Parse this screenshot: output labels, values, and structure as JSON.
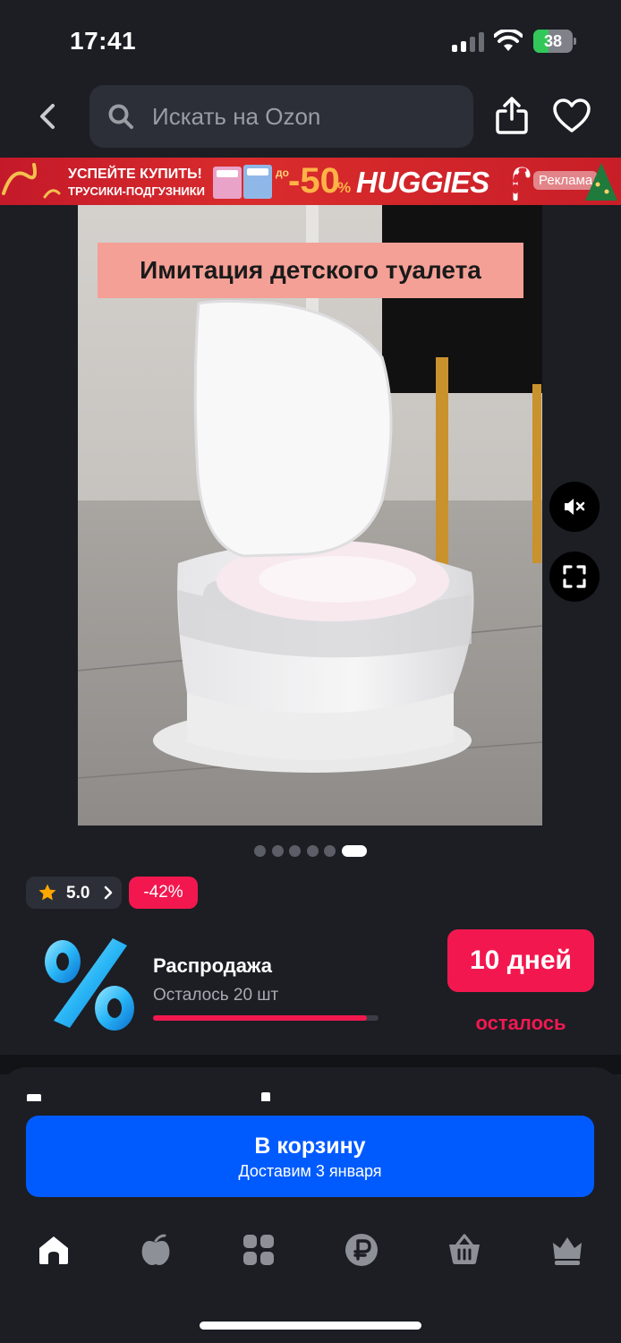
{
  "status_bar": {
    "time": "17:41",
    "battery_level": "38",
    "battery_charge_fraction": 0.38
  },
  "header": {
    "search_placeholder": "Искать на Ozon"
  },
  "promo": {
    "line1": "УСПЕЙТЕ КУПИТЬ!",
    "line2": "ТРУСИКИ-ПОДГУЗНИКИ",
    "prefix": "до",
    "discount": "-50",
    "percent": "%",
    "brand": "HUGGIES",
    "ad_label": "Реклама"
  },
  "product": {
    "video_caption": "Имитация детского туалета",
    "gallery_count": 6,
    "gallery_active_index": 5
  },
  "rating": {
    "value": "5.0"
  },
  "discount_badge": "-42%",
  "sale": {
    "title": "Распродажа",
    "remaining": "Осталось 20 шт",
    "progress_fraction": 0.95,
    "days": "10 дней",
    "days_sub": "осталось"
  },
  "cart": {
    "label": "В корзину",
    "sub": "Доставим 3 января"
  },
  "nav": {
    "items": [
      "home-icon",
      "fresh-icon",
      "catalog-icon",
      "ozon-bank-icon",
      "cart-icon",
      "premium-icon"
    ]
  },
  "colors": {
    "accent_blue": "#005bff",
    "sale_pink": "#f2184f",
    "background": "#1c1e24"
  }
}
